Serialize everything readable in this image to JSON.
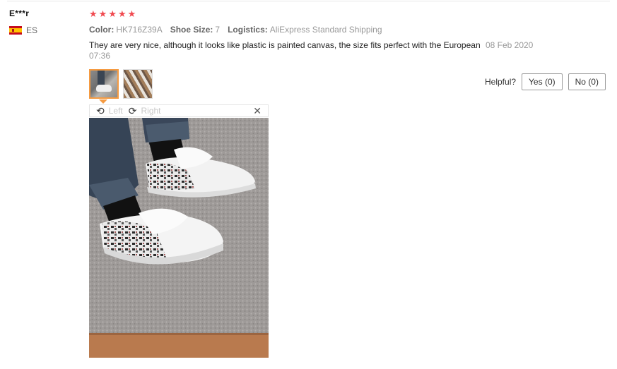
{
  "user": {
    "name": "E***r",
    "country_code": "ES",
    "flag_icon": "spain-flag-icon"
  },
  "rating": {
    "stars": 5,
    "color": "#f0494f"
  },
  "meta": {
    "color_label": "Color:",
    "color_value": "HK716Z39A",
    "size_label": "Shoe Size:",
    "size_value": "7",
    "logistics_label": "Logistics:",
    "logistics_value": "AliExpress Standard Shipping"
  },
  "review": {
    "text": "They are very nice, although it looks like plastic is painted canvas, the size fits perfect with the European",
    "date": "08 Feb 2020 07:36"
  },
  "thumbnails": [
    {
      "name": "sneakers-on-feet-photo",
      "active": true
    },
    {
      "name": "sneakers-top-view-photo",
      "active": false
    }
  ],
  "helpful": {
    "label": "Helpful?",
    "yes_label": "Yes (0)",
    "no_label": "No (0)"
  },
  "viewer": {
    "rotate_left_label": "Left",
    "rotate_right_label": "Right",
    "close_icon": "close-icon"
  },
  "colors": {
    "accent": "#f59b42",
    "star": "#f0494f"
  }
}
